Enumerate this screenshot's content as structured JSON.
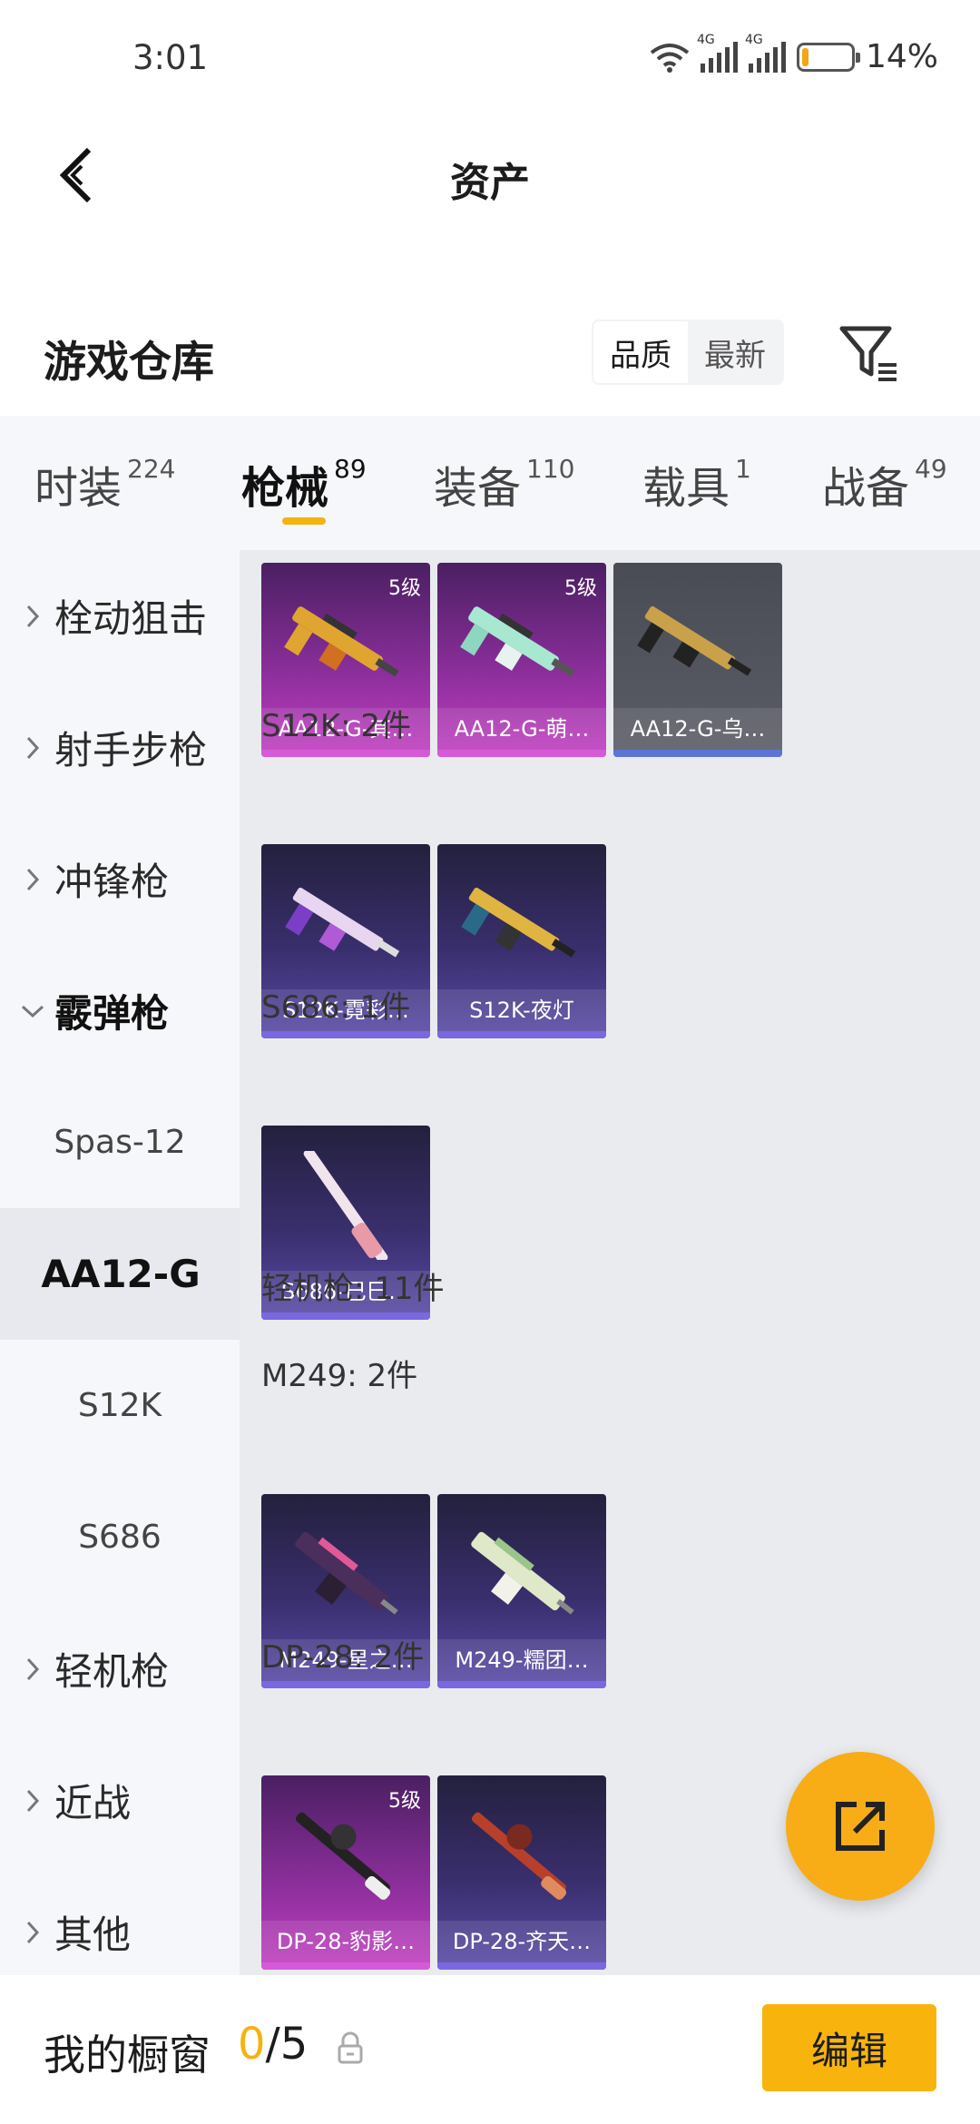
{
  "status_bar": {
    "time": "3:01",
    "battery": "14%",
    "battery_level": 0.14,
    "network_1": "4G",
    "network_2": "4G"
  },
  "header": {
    "title": "资产"
  },
  "section": {
    "title": "游戏仓库",
    "sort_options": [
      "品质",
      "最新"
    ],
    "sort_active": "品质"
  },
  "tabs": [
    {
      "label": "时装",
      "count": "224"
    },
    {
      "label": "枪械",
      "count": "89"
    },
    {
      "label": "装备",
      "count": "110"
    },
    {
      "label": "载具",
      "count": "1"
    },
    {
      "label": "战备",
      "count": "49"
    }
  ],
  "active_tab": "枪械",
  "sidebar": {
    "categories": [
      "栓动狙击",
      "射手步枪",
      "冲锋枪",
      "霰弹枪",
      "轻机枪",
      "近战",
      "其他"
    ],
    "sub_items": [
      "Spas-12",
      "AA12-G",
      "S12K",
      "S686"
    ],
    "selected": "AA12-G"
  },
  "content": {
    "groups": [
      {
        "label": "",
        "items": [
          {
            "name": "AA12-G-其…",
            "level": "5级",
            "rarity": "purple"
          },
          {
            "name": "AA12-G-萌…",
            "level": "5级",
            "rarity": "purple"
          },
          {
            "name": "AA12-G-乌…",
            "level": "",
            "rarity": "gray"
          }
        ]
      },
      {
        "label": "S12K: 2件",
        "items": [
          {
            "name": "S12K-霓彩…",
            "level": "",
            "rarity": "blue"
          },
          {
            "name": "S12K-夜灯",
            "level": "",
            "rarity": "blue"
          }
        ]
      },
      {
        "label": "S686: 1件",
        "items": [
          {
            "name": "S686-巳巳…",
            "level": "",
            "rarity": "blue"
          }
        ]
      },
      {
        "label": "轻机枪: 11件",
        "items": []
      },
      {
        "label": "M249: 2件",
        "items": [
          {
            "name": "M249-星之…",
            "level": "",
            "rarity": "blue"
          },
          {
            "name": "M249-糯团…",
            "level": "",
            "rarity": "blue"
          }
        ]
      },
      {
        "label": "DP-28: 2件",
        "items": [
          {
            "name": "DP-28-豹影…",
            "level": "5级",
            "rarity": "purple"
          },
          {
            "name": "DP-28-齐天…",
            "level": "",
            "rarity": "blue"
          }
        ]
      }
    ]
  },
  "bottom_bar": {
    "label": "我的橱窗",
    "current": "0",
    "separator_total": "/5",
    "edit_label": "编辑"
  },
  "colors": {
    "accent": "#f8b40c",
    "purple_rarity": "#c23fc1",
    "blue_rarity": "#5a4aa8",
    "content_bg": "#e9ebef"
  }
}
